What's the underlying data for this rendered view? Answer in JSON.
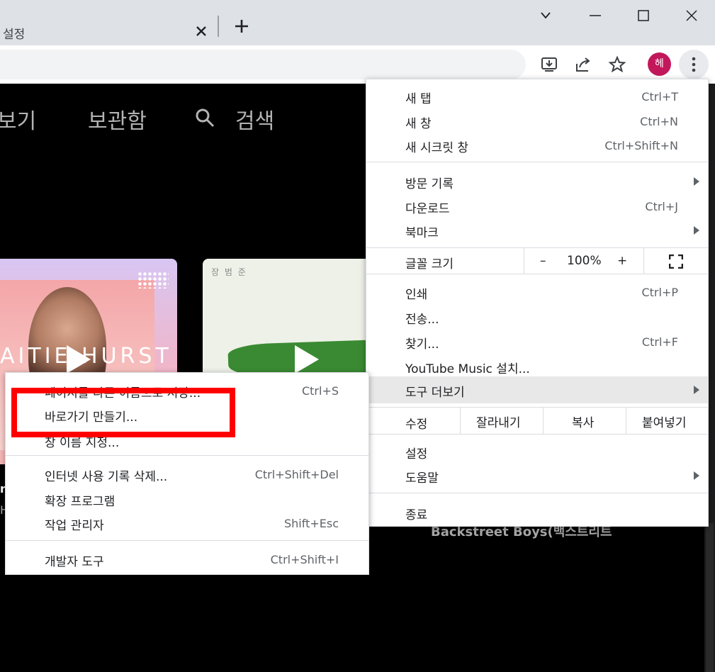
{
  "tab": {
    "title": "설정"
  },
  "toolbar": {
    "avatar_letter": "헤"
  },
  "page": {
    "nav": [
      "보기",
      "보관함",
      "검색"
    ],
    "card1_text": "AITIE HURST",
    "card2_label": "장 범 준",
    "artist_text": "Backstreet Boys(백스트리트",
    "edge_frags": [
      "n",
      "H"
    ]
  },
  "menu": {
    "new_tab": {
      "label": "새 탭",
      "shortcut": "Ctrl+T"
    },
    "new_window": {
      "label": "새 창",
      "shortcut": "Ctrl+N"
    },
    "incognito": {
      "label": "새 시크릿 창",
      "shortcut": "Ctrl+Shift+N"
    },
    "history": {
      "label": "방문 기록"
    },
    "downloads": {
      "label": "다운로드",
      "shortcut": "Ctrl+J"
    },
    "bookmarks": {
      "label": "북마크"
    },
    "zoom": {
      "label": "글꼴 크기",
      "minus": "–",
      "value": "100%",
      "plus": "+"
    },
    "print": {
      "label": "인쇄",
      "shortcut": "Ctrl+P"
    },
    "cast": {
      "label": "전송..."
    },
    "find": {
      "label": "찾기...",
      "shortcut": "Ctrl+F"
    },
    "install": {
      "label": "YouTube Music 설치..."
    },
    "more_tools": {
      "label": "도구 더보기"
    },
    "edit": {
      "label": "수정",
      "cut": "잘라내기",
      "copy": "복사",
      "paste": "붙여넣기"
    },
    "settings": {
      "label": "설정"
    },
    "help": {
      "label": "도움말"
    },
    "exit": {
      "label": "종료"
    }
  },
  "submenu": {
    "save_page": {
      "label": "페이지를 다른 이름으로 저장...",
      "shortcut": "Ctrl+S"
    },
    "create_shortcut": {
      "label": "바로가기 만들기..."
    },
    "name_window": {
      "label": "창 이름 지정..."
    },
    "clear_data": {
      "label": "인터넷 사용 기록 삭제...",
      "shortcut": "Ctrl+Shift+Del"
    },
    "extensions": {
      "label": "확장 프로그램"
    },
    "task_manager": {
      "label": "작업 관리자",
      "shortcut": "Shift+Esc"
    },
    "devtools": {
      "label": "개발자 도구",
      "shortcut": "Ctrl+Shift+I"
    }
  }
}
